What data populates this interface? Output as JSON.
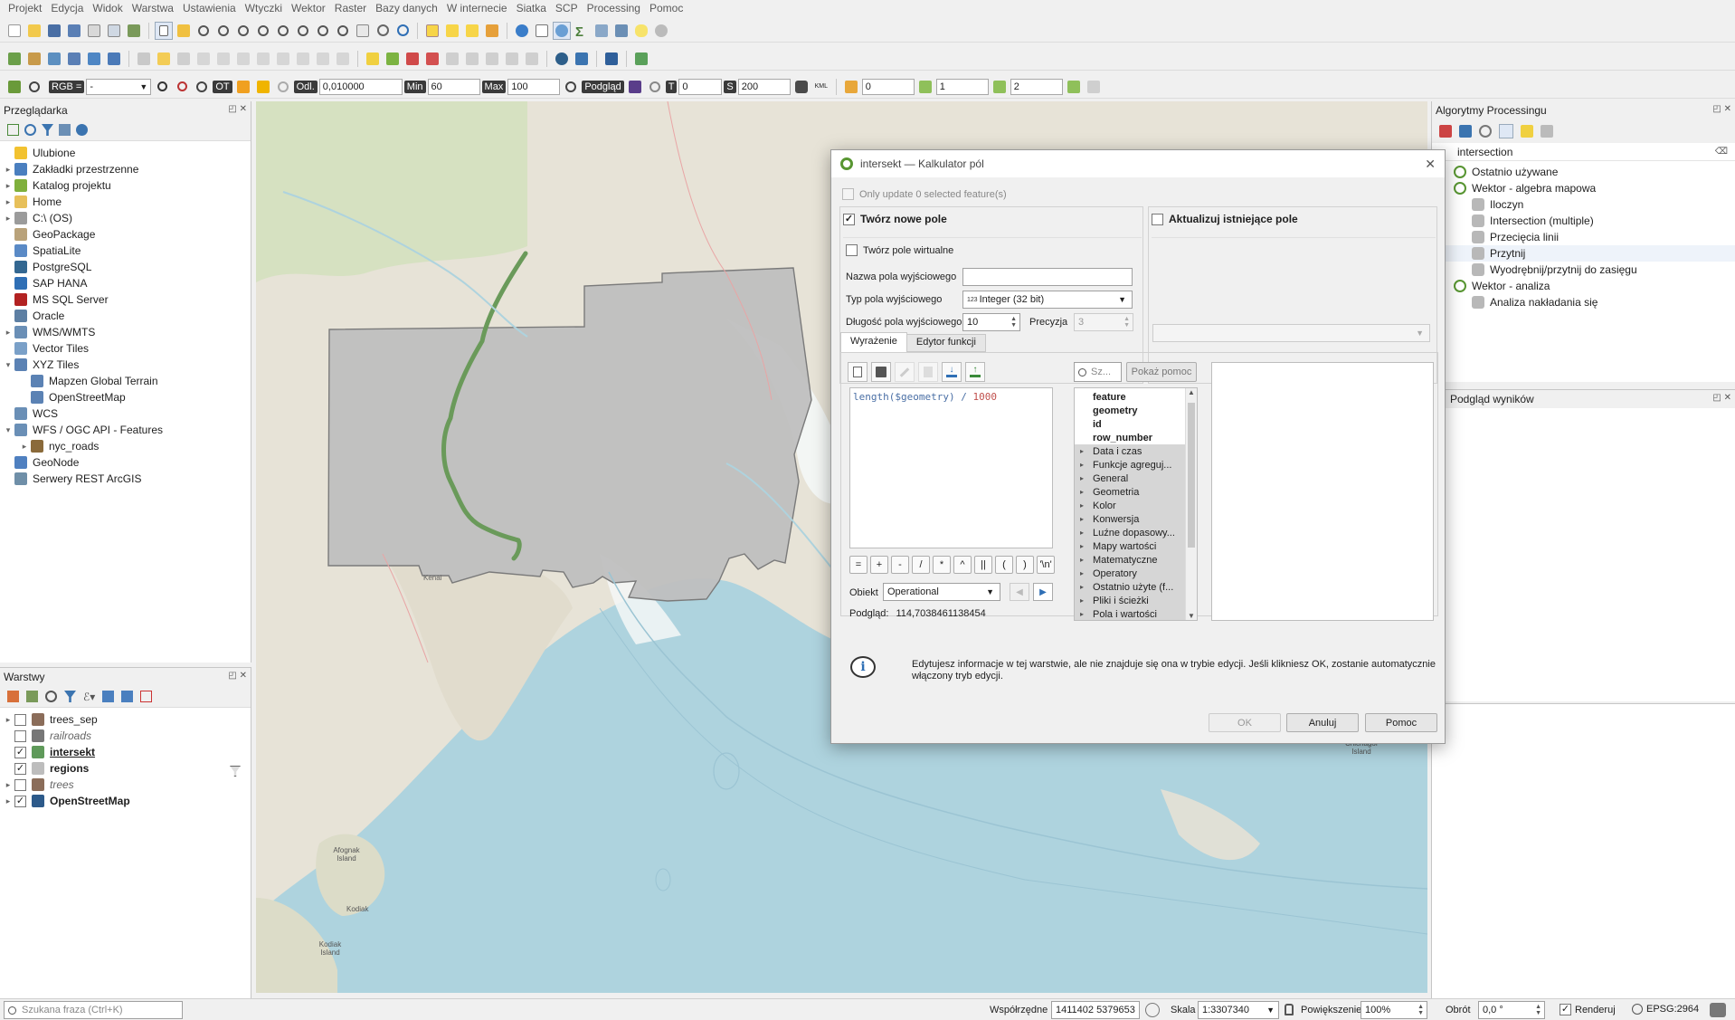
{
  "menu": [
    "Projekt",
    "Edycja",
    "Widok",
    "Warstwa",
    "Ustawienia",
    "Wtyczki",
    "Wektor",
    "Raster",
    "Bazy danych",
    "W internecie",
    "Siatka",
    "SCP",
    "Processing",
    "Pomoc"
  ],
  "toolbar3": {
    "rgb_label": "RGB =",
    "rgb_value": "-",
    "ot_label": "OT",
    "odl_label": "Odl.",
    "odl_value": "0,010000",
    "min_label": "Min",
    "min_value": "60",
    "max_label": "Max",
    "max_value": "100",
    "preview_label": "Podgląd",
    "t_label": "T",
    "t_value": "0",
    "s_label": "S",
    "s_value": "200",
    "kml_label": "KML",
    "v1": "0",
    "v2": "1",
    "v3": "2"
  },
  "browser": {
    "title": "Przeglądarka",
    "items": [
      {
        "label": "Ulubione",
        "expand": "",
        "indent": 0,
        "color": "#f2c230"
      },
      {
        "label": "Zakładki przestrzenne",
        "expand": "▸",
        "indent": 0,
        "color": "#4a7fbf"
      },
      {
        "label": "Katalog projektu",
        "expand": "▸",
        "indent": 0,
        "color": "#7fb03c"
      },
      {
        "label": "Home",
        "expand": "▸",
        "indent": 0,
        "color": "#e7c05a"
      },
      {
        "label": "C:\\ (OS)",
        "expand": "▸",
        "indent": 0,
        "color": "#9b9b9b"
      },
      {
        "label": "GeoPackage",
        "expand": "",
        "indent": 0,
        "color": "#b9a27a"
      },
      {
        "label": "SpatiaLite",
        "expand": "",
        "indent": 0,
        "color": "#5a8ac6"
      },
      {
        "label": "PostgreSQL",
        "expand": "",
        "indent": 0,
        "color": "#336791"
      },
      {
        "label": "SAP HANA",
        "expand": "",
        "indent": 0,
        "color": "#2f6fb5"
      },
      {
        "label": "MS SQL Server",
        "expand": "",
        "indent": 0,
        "color": "#b22222"
      },
      {
        "label": "Oracle",
        "expand": "",
        "indent": 0,
        "color": "#5d7fa3"
      },
      {
        "label": "WMS/WMTS",
        "expand": "▸",
        "indent": 0,
        "color": "#6a8fb6"
      },
      {
        "label": "Vector Tiles",
        "expand": "",
        "indent": 0,
        "color": "#7aa0c8"
      },
      {
        "label": "XYZ Tiles",
        "expand": "▾",
        "indent": 0,
        "color": "#5b82b4"
      },
      {
        "label": "Mapzen Global Terrain",
        "expand": "",
        "indent": 1,
        "color": "#5b82b4"
      },
      {
        "label": "OpenStreetMap",
        "expand": "",
        "indent": 1,
        "color": "#5b82b4"
      },
      {
        "label": "WCS",
        "expand": "",
        "indent": 0,
        "color": "#6a8fb6"
      },
      {
        "label": "WFS / OGC API - Features",
        "expand": "▾",
        "indent": 0,
        "color": "#6a8fb6"
      },
      {
        "label": "nyc_roads",
        "expand": "▸",
        "indent": 1,
        "color": "#8a6a3a"
      },
      {
        "label": "GeoNode",
        "expand": "",
        "indent": 0,
        "color": "#4f80c0"
      },
      {
        "label": "Serwery REST ArcGIS",
        "expand": "",
        "indent": 0,
        "color": "#6f8fa8"
      }
    ]
  },
  "layers": {
    "title": "Warstwy",
    "items": [
      {
        "label": "trees_sep",
        "checked": "",
        "bold": false,
        "italic": false,
        "expand": "▸",
        "color": "#8b6d5a"
      },
      {
        "label": "railroads",
        "checked": "",
        "bold": false,
        "italic": true,
        "expand": "",
        "color": "#777777"
      },
      {
        "label": "intersekt",
        "checked": "✓",
        "bold": true,
        "italic": false,
        "expand": "",
        "color": "#5f9a5a",
        "underline": true
      },
      {
        "label": "regions",
        "checked": "✓",
        "bold": true,
        "italic": false,
        "expand": "",
        "color": "#bdbdbd"
      },
      {
        "label": "trees",
        "checked": "",
        "bold": false,
        "italic": true,
        "expand": "▸",
        "color": "#8b6d5a"
      },
      {
        "label": "OpenStreetMap",
        "checked": "✓",
        "bold": true,
        "italic": false,
        "expand": "▸",
        "color": "#2d5a8a"
      }
    ]
  },
  "search_placeholder": "Szukana fraza (Ctrl+K)",
  "processing": {
    "title": "Algorytmy Processingu",
    "search_value": "intersection",
    "items": [
      {
        "label": "Ostatnio używane",
        "indent": 0,
        "group": true
      },
      {
        "label": "Wektor - algebra mapowa",
        "indent": 0,
        "group": true
      },
      {
        "label": "Iloczyn",
        "indent": 1,
        "group": false
      },
      {
        "label": "Intersection (multiple)",
        "indent": 1,
        "group": false
      },
      {
        "label": "Przecięcia linii",
        "indent": 1,
        "group": false
      },
      {
        "label": "Przytnij",
        "indent": 1,
        "group": false
      },
      {
        "label": "Wyodrębnij/przytnij do zasięgu",
        "indent": 1,
        "group": false
      },
      {
        "label": "Wektor - analiza",
        "indent": 0,
        "group": true
      },
      {
        "label": "Analiza nakładania się",
        "indent": 1,
        "group": false
      }
    ]
  },
  "results_viewer": {
    "title": "Podgląd wyników"
  },
  "map_labels": {
    "kenai": "Kenai",
    "afognak": "Afognak Island",
    "kodiak": "Kodiak Island",
    "kodiak_town": "Kodiak",
    "chichagof": "Chichagof Island"
  },
  "dialog": {
    "title": "intersekt — Kalkulator pól",
    "only_update": "Only update 0 selected feature(s)",
    "create_new": "Twórz nowe pole",
    "update_existing": "Aktualizuj istniejące pole",
    "virtual_field": "Twórz pole wirtualne",
    "out_name_label": "Nazwa pola wyjściowego",
    "out_name_value": "",
    "out_type_label": "Typ pola wyjściowego",
    "out_type_prefix": "1 2 3",
    "out_type_value": "Integer (32 bit)",
    "out_length_label": "Długość pola wyjściowego",
    "out_length_value": "10",
    "precision_label": "Precyzja",
    "precision_value": "3",
    "tab_expression": "Wyrażenie",
    "tab_functions": "Edytor funkcji",
    "expr_func": "length(",
    "expr_var": "$geometry",
    "expr_close": ") / ",
    "expr_num": "1000",
    "search_placeholder": "Sz...",
    "show_help": "Pokaż pomoc",
    "operators": [
      "=",
      "+",
      "-",
      "/",
      "*",
      "^",
      "||",
      "(",
      ")",
      "'\\n'"
    ],
    "feature_label": "Obiekt",
    "feature_value": "Operational",
    "preview_label": "Podgląd:",
    "preview_value": "114,7038461138454",
    "function_list": [
      {
        "label": "feature",
        "bold": true,
        "group": false
      },
      {
        "label": "geometry",
        "bold": true,
        "group": false
      },
      {
        "label": "id",
        "bold": true,
        "group": false
      },
      {
        "label": "row_number",
        "bold": true,
        "group": false
      },
      {
        "label": "Data i czas",
        "bold": false,
        "group": true
      },
      {
        "label": "Funkcje agreguj...",
        "bold": false,
        "group": true
      },
      {
        "label": "General",
        "bold": false,
        "group": true
      },
      {
        "label": "Geometria",
        "bold": false,
        "group": true
      },
      {
        "label": "Kolor",
        "bold": false,
        "group": true
      },
      {
        "label": "Konwersja",
        "bold": false,
        "group": true
      },
      {
        "label": "Luźne dopasowy...",
        "bold": false,
        "group": true
      },
      {
        "label": "Mapy wartości",
        "bold": false,
        "group": true
      },
      {
        "label": "Matematyczne",
        "bold": false,
        "group": true
      },
      {
        "label": "Operatory",
        "bold": false,
        "group": true
      },
      {
        "label": "Ostatnio użyte (f...",
        "bold": false,
        "group": true
      },
      {
        "label": "Pliki i ścieżki",
        "bold": false,
        "group": true
      },
      {
        "label": "Pola i wartości",
        "bold": false,
        "group": true
      }
    ],
    "info": "Edytujesz informacje w tej warstwie, ale nie znajduje się ona w trybie edycji. Jeśli klikniesz OK, zostanie automatycznie włączony tryb edycji.",
    "ok": "OK",
    "cancel": "Anuluj",
    "help": "Pomoc"
  },
  "status": {
    "coord_label": "Współrzędne",
    "coord_value": "1411402 5379653",
    "scale_label": "Skala",
    "scale_value": "1:3307340",
    "zoom_label": "Powiększenie",
    "zoom_value": "100%",
    "rotation_label": "Obrót",
    "rotation_value": "0,0 °",
    "render_label": "Renderuj",
    "crs": "EPSG:2964"
  }
}
